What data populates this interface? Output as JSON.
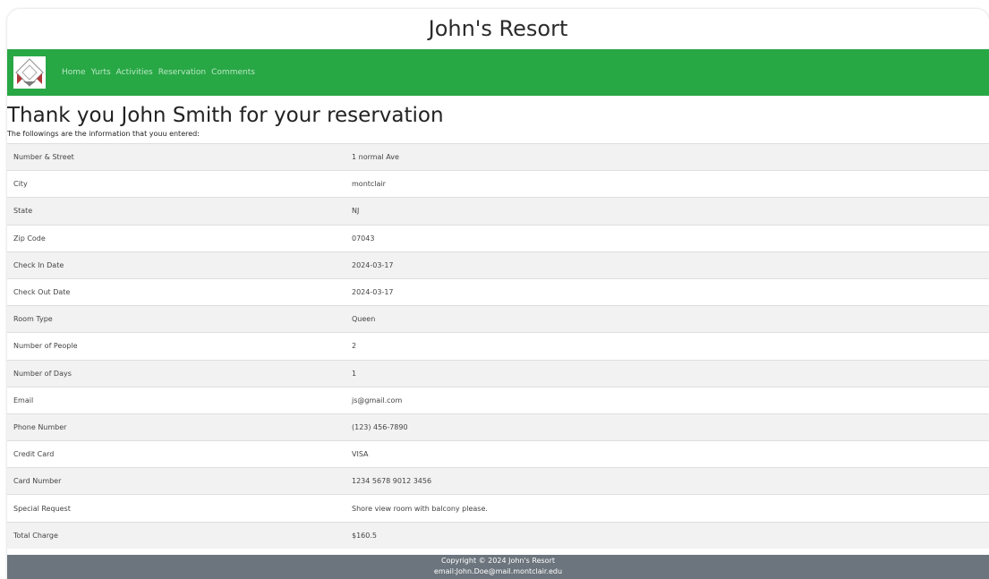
{
  "site": {
    "title": "John's Resort"
  },
  "nav": {
    "logo": "resort-logo",
    "links": [
      "Home",
      "Yurts",
      "Activities",
      "Reservation",
      "Comments"
    ]
  },
  "page": {
    "heading": "Thank you John Smith for your reservation",
    "subtext": "The followings are the information that youu entered:"
  },
  "reservation": [
    {
      "label": "Number & Street",
      "value": "1 normal Ave"
    },
    {
      "label": "City",
      "value": "montclair"
    },
    {
      "label": "State",
      "value": "NJ"
    },
    {
      "label": "Zip Code",
      "value": "07043"
    },
    {
      "label": "Check In Date",
      "value": "2024-03-17"
    },
    {
      "label": "Check Out Date",
      "value": "2024-03-17"
    },
    {
      "label": "Room Type",
      "value": "Queen"
    },
    {
      "label": "Number of People",
      "value": "2"
    },
    {
      "label": "Number of Days",
      "value": "1"
    },
    {
      "label": "Email",
      "value": "js@gmail.com"
    },
    {
      "label": "Phone Number",
      "value": "(123) 456-7890"
    },
    {
      "label": "Credit Card",
      "value": "VISA"
    },
    {
      "label": "Card Number",
      "value": "1234 5678 9012 3456"
    },
    {
      "label": "Special Request",
      "value": "Shore view room with balcony please."
    },
    {
      "label": "Total Charge",
      "value": "$160.5"
    }
  ],
  "footer": {
    "copyright": "Copyright © 2024 John's Resort",
    "email": "email:John.Doe@mail.montclair.edu"
  },
  "colors": {
    "navbar": "#28a745",
    "footer": "#6c757d",
    "row_stripe": "#f2f2f2"
  }
}
